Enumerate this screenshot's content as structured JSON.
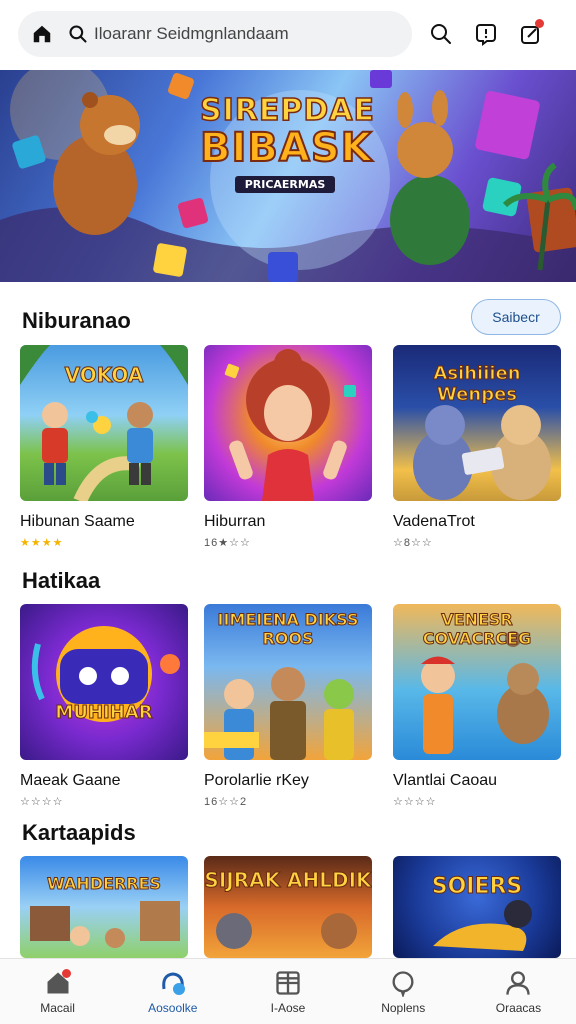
{
  "search": {
    "placeholder": "Iloaranr Seidmgnlandaam"
  },
  "banner": {
    "title_line1": "SIREPDAE",
    "title_line2": "BIBASK",
    "subtitle": "PRICAERMAS"
  },
  "sections": [
    {
      "title": "Niburanao",
      "see_all_label": "Saibecr",
      "cards": [
        {
          "thumb_text": "VOKOA",
          "name": "Hibunan Saame",
          "stars": "★★★★",
          "colors": [
            "#4a9be0",
            "#7cc24a"
          ]
        },
        {
          "thumb_text": "",
          "name": "Hiburran",
          "meta": "16★☆☆",
          "colors": [
            "#8e3fd8",
            "#f08a2a"
          ]
        },
        {
          "thumb_text": "Asihiiien Wenpes",
          "name": "VadenaTrot",
          "meta": "☆8☆☆",
          "colors": [
            "#2a4fa8",
            "#f2c04a"
          ]
        }
      ]
    },
    {
      "title": "Hatikaa",
      "cards": [
        {
          "thumb_text": "MUHIHAR",
          "name": "Maeak Gaane",
          "meta": "☆☆☆☆",
          "colors": [
            "#5a1fb8",
            "#c23ad8"
          ]
        },
        {
          "thumb_text": "IIMEIENA DIKSS ROOS",
          "name": "Porolarlie rKey",
          "meta": "16☆☆2",
          "colors": [
            "#3a7ad8",
            "#f2a43a"
          ]
        },
        {
          "thumb_text": "VENESR COVACRCEG",
          "name": "Vlantlai Caoau",
          "meta": "☆☆☆☆",
          "colors": [
            "#58b8e8",
            "#f0b85a"
          ]
        }
      ]
    },
    {
      "title": "Kartaapids",
      "cards": [
        {
          "thumb_text": "WAHDERRES",
          "colors": [
            "#3a8ae8",
            "#8fd06a"
          ]
        },
        {
          "thumb_text": "SIJRAK AHLDIK",
          "colors": [
            "#d86a2a",
            "#5a2a18"
          ]
        },
        {
          "thumb_text": "SOIERS",
          "colors": [
            "#1a3a98",
            "#3a6ad8"
          ]
        }
      ]
    }
  ],
  "bottom_nav": [
    {
      "label": "Macail",
      "icon": "home-icon"
    },
    {
      "label": "Aosoolke",
      "icon": "games-controller-icon",
      "active": true
    },
    {
      "label": "I-Aose",
      "icon": "grid-icon"
    },
    {
      "label": "Noplens",
      "icon": "chat-bubble-icon"
    },
    {
      "label": "Oraacas",
      "icon": "profile-icon"
    }
  ],
  "colors": {
    "accent": "#1e5aa8",
    "badge": "#e53935",
    "stars": "#f5b400"
  }
}
